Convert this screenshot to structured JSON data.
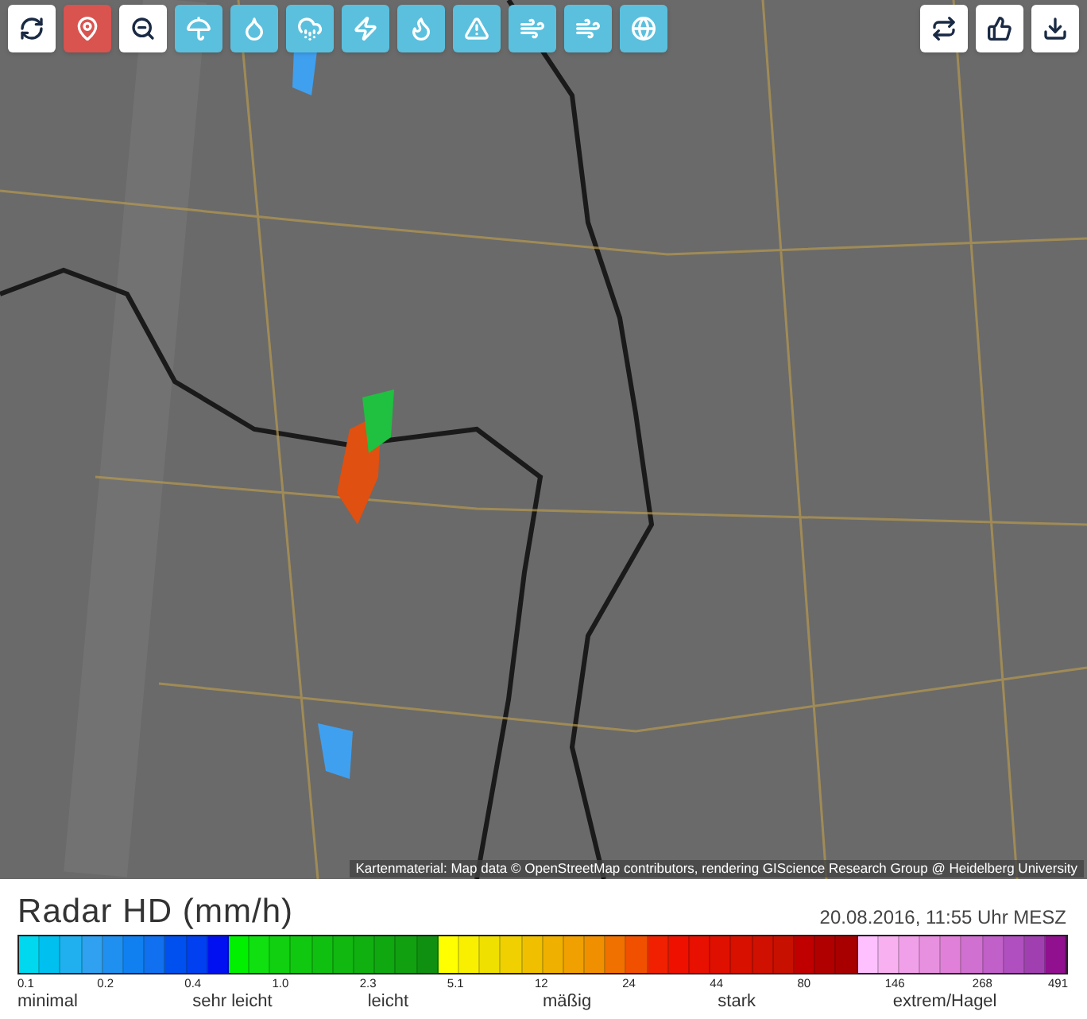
{
  "toolbar_left": [
    {
      "kind": "tool",
      "selected": false
    },
    {
      "kind": "tool",
      "selected": true
    },
    {
      "kind": "tool",
      "selected": false
    },
    {
      "kind": "layer",
      "selected": false
    },
    {
      "kind": "layer",
      "selected": false
    },
    {
      "kind": "layer",
      "selected": false
    },
    {
      "kind": "layer",
      "selected": false
    },
    {
      "kind": "layer",
      "selected": false
    },
    {
      "kind": "layer",
      "selected": false
    },
    {
      "kind": "layer",
      "selected": false
    },
    {
      "kind": "layer",
      "selected": false
    },
    {
      "kind": "layer",
      "selected": false
    }
  ],
  "toolbar_right": [
    {
      "kind": "tool",
      "selected": false
    },
    {
      "kind": "tool",
      "selected": false
    },
    {
      "kind": "tool",
      "selected": false
    }
  ],
  "map": {
    "attribution": "Kartenmaterial: Map data © OpenStreetMap contributors, rendering GIScience Research Group @ Heidelberg University"
  },
  "legend": {
    "title": "Radar HD (mm/h)",
    "timestamp": "20.08.2016, 11:55 Uhr MESZ",
    "ticks": [
      "0.1",
      "0.2",
      "0.4",
      "1.0",
      "2.3",
      "5.1",
      "12",
      "24",
      "44",
      "80",
      "146",
      "268",
      "491"
    ],
    "categories": [
      "minimal",
      "sehr leicht",
      "leicht",
      "mäßig",
      "stark",
      "extrem/Hagel"
    ]
  }
}
